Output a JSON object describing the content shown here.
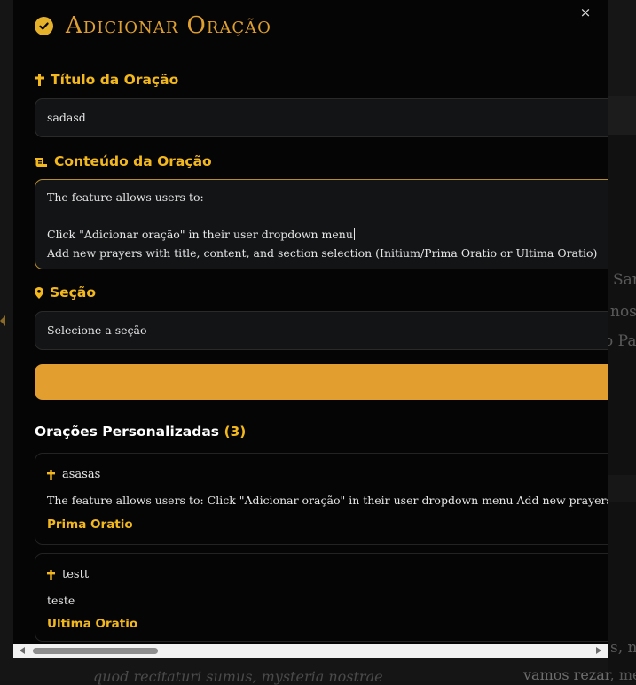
{
  "modal": {
    "title": "Adicionar Oração",
    "close_label": "×",
    "icons": {
      "title": "check-circle-icon",
      "close": "close-icon"
    }
  },
  "form": {
    "title_label": "Título da Oração",
    "title_icon": "cross-icon",
    "title_value": "sadasd",
    "content_label": "Conteúdo da Oração",
    "content_icon": "scroll-icon",
    "content_lines": [
      "The feature allows users to:",
      "",
      "Click \"Adicionar oração\" in their user dropdown menu",
      "Add new prayers with title, content, and section selection (Initium/Prima Oratio or Ultima Oratio)"
    ],
    "section_label": "Seção",
    "section_icon": "location-pin-icon",
    "section_placeholder": "Selecione a seção",
    "submit_label": ""
  },
  "custom_prayers": {
    "heading": "Orações Personalizadas",
    "count": "(3)",
    "items": [
      {
        "title": "asasas",
        "content": "The feature allows users to: Click \"Adicionar oração\" in their user dropdown menu Add new prayers with title, content",
        "section": "Prima Oratio"
      },
      {
        "title": "testt",
        "content": "teste",
        "section": "Ultima Oratio"
      }
    ]
  },
  "background": {
    "fragments": [
      "Sar",
      "nos",
      "o Pai",
      "s, nó",
      "vamos rezar, me",
      "quod recitaturi sumus, mysteria nostrae"
    ]
  },
  "colors": {
    "accent": "#f2b81e",
    "title_gold": "#e0a030",
    "button": "#e29e2f",
    "modal_bg": "#050505",
    "field_bg": "#131416"
  }
}
